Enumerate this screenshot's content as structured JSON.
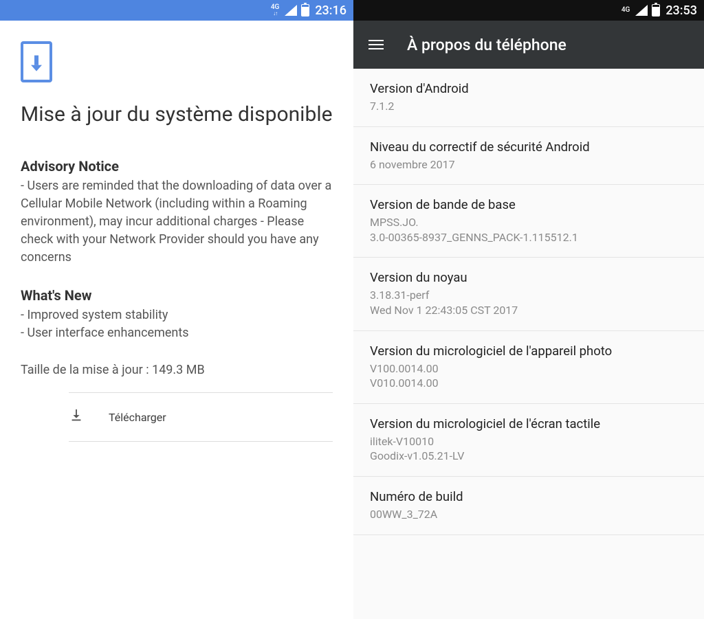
{
  "left": {
    "status": {
      "net": "4G",
      "time": "23:16"
    },
    "title": "Mise à jour du système disponible",
    "advisory_heading": "Advisory Notice",
    "advisory_body": "- Users are reminded that the downloading of data over a Cellular Mobile Network (including within a Roaming environment), may incur additional charges - Please check with your Network Provider should you have any concerns",
    "whatsnew_heading": "What's New",
    "whatsnew_body": "- Improved system stability\n- User interface enhancements",
    "size_line": "Taille de la mise à jour : 149.3 MB",
    "download_label": "Télécharger"
  },
  "right": {
    "status": {
      "net": "4G",
      "time": "23:53"
    },
    "appbar_title": "À propos du téléphone",
    "items": [
      {
        "title": "Version d'Android",
        "value": "7.1.2"
      },
      {
        "title": "Niveau du correctif de sécurité Android",
        "value": "6 novembre 2017"
      },
      {
        "title": "Version de bande de base",
        "value": "MPSS.JO.\n3.0-00365-8937_GENNS_PACK-1.115512.1"
      },
      {
        "title": "Version du noyau",
        "value": "3.18.31-perf\nWed Nov 1 22:43:05 CST 2017"
      },
      {
        "title": "Version du micrologiciel de l'appareil photo",
        "value": "V100.0014.00\nV010.0014.00"
      },
      {
        "title": "Version du micrologiciel de l'écran tactile",
        "value": "ilitek-V10010\nGoodix-v1.05.21-LV"
      },
      {
        "title": "Numéro de build",
        "value": "00WW_3_72A"
      }
    ]
  }
}
